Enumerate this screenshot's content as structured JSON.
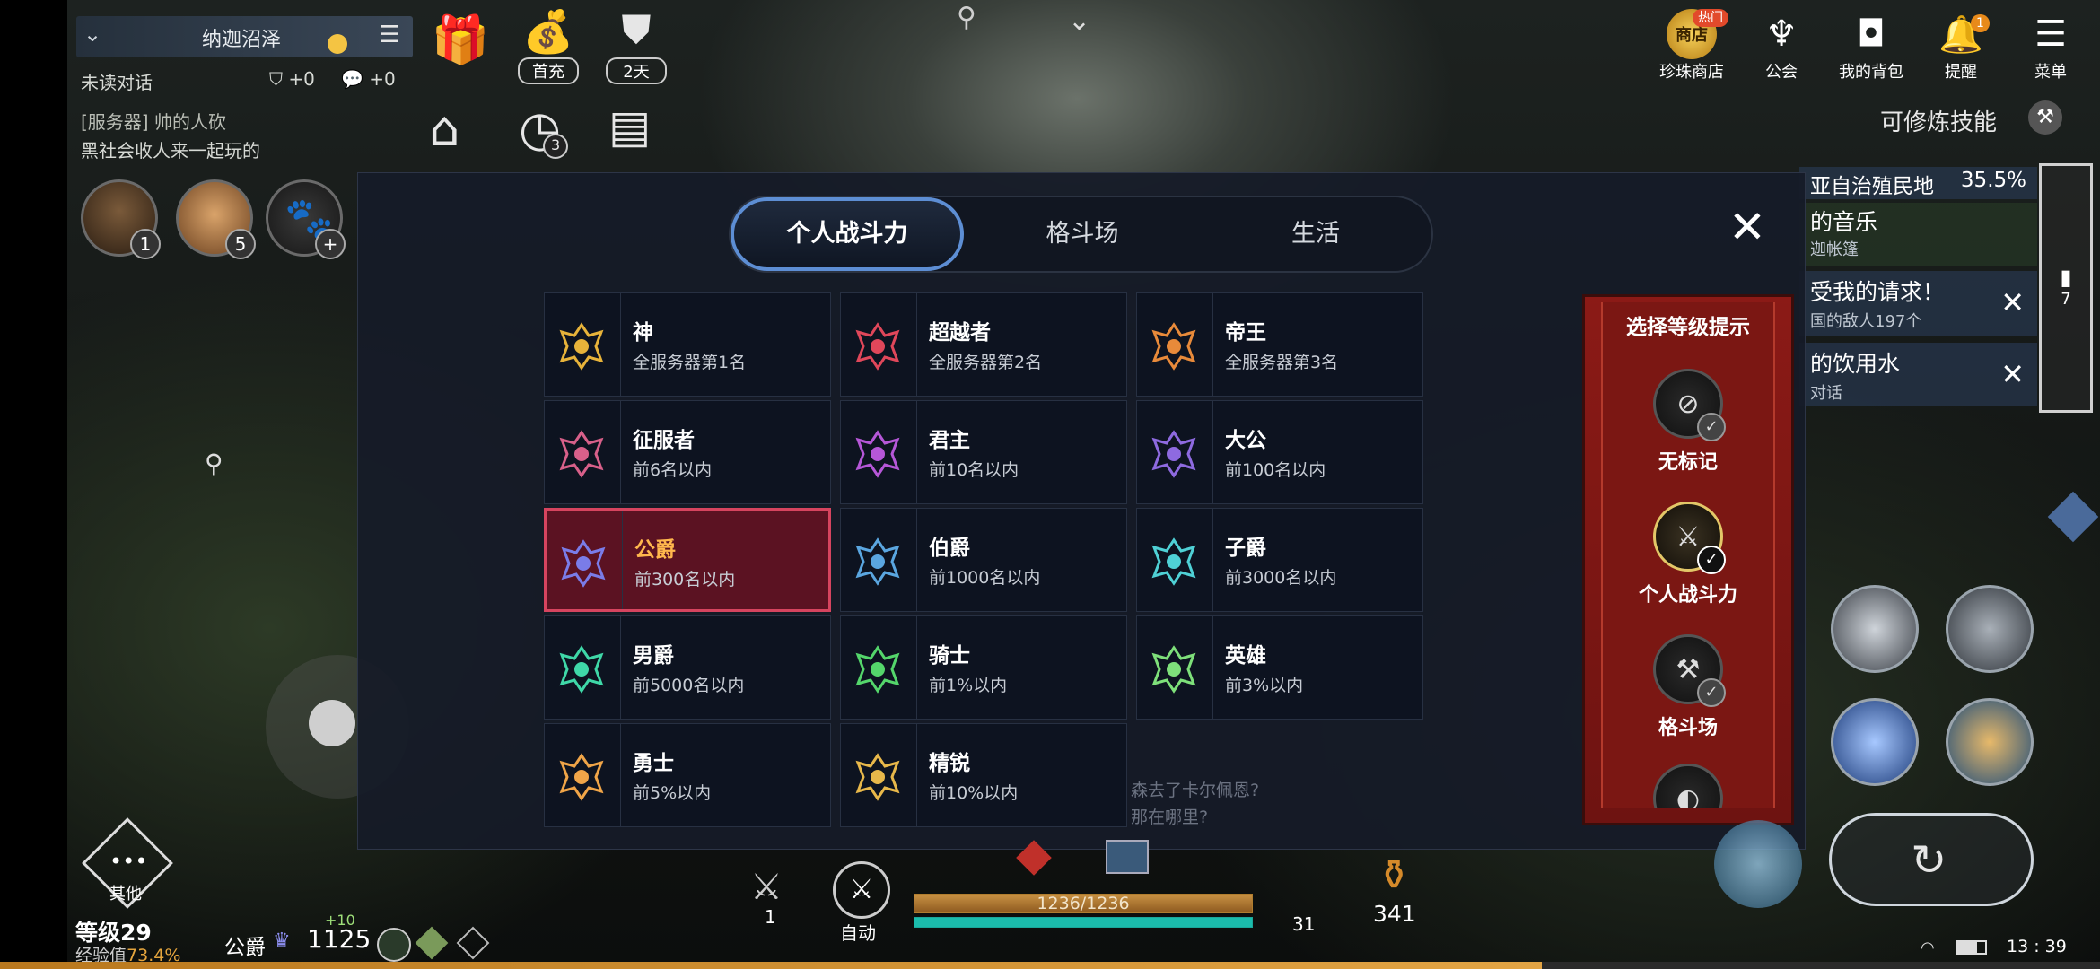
{
  "top_left": {
    "zone_name": "纳迦沼泽",
    "unread_label": "未读对话",
    "shield_count": "+0",
    "chat_count": "+0",
    "chat_lines": [
      "[服务器] 帅的人砍",
      "黑社会收人来一起玩的"
    ],
    "shortcuts": [
      {
        "icon": "gift-icon",
        "label": ""
      },
      {
        "icon": "money-bag-icon",
        "label": "首充"
      },
      {
        "icon": "shield-badge-icon",
        "label": "2天"
      }
    ],
    "shortcuts2": [
      {
        "icon": "house-icon",
        "badge": ""
      },
      {
        "icon": "timer-icon",
        "badge": "3"
      },
      {
        "icon": "board-icon",
        "badge": ""
      }
    ],
    "party": [
      {
        "icon": "boar-avatar-icon",
        "num": "1"
      },
      {
        "icon": "dog-avatar-icon",
        "num": "5"
      },
      {
        "icon": "paw-avatar-icon",
        "num": "+"
      }
    ]
  },
  "top_right": {
    "icons": [
      {
        "name": "pearl-shop",
        "label": "珍珠商店",
        "badge": "热门",
        "glyph": "商店"
      },
      {
        "name": "guild",
        "label": "公会",
        "badge": "",
        "glyph": "♆"
      },
      {
        "name": "bag",
        "label": "我的背包",
        "badge": "",
        "glyph": "◘"
      },
      {
        "name": "alert",
        "label": "提醒",
        "badge": "1",
        "glyph": "🔔"
      },
      {
        "name": "menu",
        "label": "菜单",
        "badge": "",
        "glyph": "☰"
      }
    ],
    "skill_notice": "可修炼技能"
  },
  "quests": [
    {
      "title": "亚自治殖民地",
      "sub": "",
      "value": "35.5%"
    },
    {
      "title": "的音乐",
      "sub": "迦帐篷"
    },
    {
      "title": "受我的请求！",
      "sub": "国的敌人197个"
    },
    {
      "title": "的饮用水",
      "sub": "对话"
    }
  ],
  "side_counter": "7",
  "modal": {
    "tabs": [
      "个人战斗力",
      "格斗场",
      "生活"
    ],
    "active_tab": 0,
    "ranks": [
      {
        "title": "神",
        "desc": "全服务器第1名",
        "color": "#e7b33a",
        "icon": "god-emblem-icon"
      },
      {
        "title": "超越者",
        "desc": "全服务器第2名",
        "color": "#e0475a",
        "icon": "transcender-emblem-icon"
      },
      {
        "title": "帝王",
        "desc": "全服务器第3名",
        "color": "#e88a3a",
        "icon": "emperor-emblem-icon"
      },
      {
        "title": "征服者",
        "desc": "前6名以内",
        "color": "#d8608a",
        "icon": "conqueror-emblem-icon"
      },
      {
        "title": "君主",
        "desc": "前10名以内",
        "color": "#b657d8",
        "icon": "monarch-emblem-icon"
      },
      {
        "title": "大公",
        "desc": "前100名以内",
        "color": "#8e6ae0",
        "icon": "archduke-emblem-icon"
      },
      {
        "title": "公爵",
        "desc": "前300名以内",
        "color": "#7a7ce8",
        "icon": "duke-emblem-icon"
      },
      {
        "title": "伯爵",
        "desc": "前1000名以内",
        "color": "#5aa6e0",
        "icon": "count-emblem-icon"
      },
      {
        "title": "子爵",
        "desc": "前3000名以内",
        "color": "#4fd1d6",
        "icon": "viscount-emblem-icon"
      },
      {
        "title": "男爵",
        "desc": "前5000名以内",
        "color": "#3fd8a8",
        "icon": "baron-emblem-icon"
      },
      {
        "title": "骑士",
        "desc": "前1%以内",
        "color": "#54d66b",
        "icon": "knight-emblem-icon"
      },
      {
        "title": "英雄",
        "desc": "前3%以内",
        "color": "#7ee07a",
        "icon": "hero-emblem-icon"
      },
      {
        "title": "勇士",
        "desc": "前5%以内",
        "color": "#f0a548",
        "icon": "warrior-emblem-icon"
      },
      {
        "title": "精锐",
        "desc": "前10%以内",
        "color": "#e8b84a",
        "icon": "elite-emblem-icon"
      }
    ],
    "selected_rank": 6,
    "close_label": "✕",
    "panel": {
      "title": "选择等级提示",
      "options": [
        {
          "label": "无标记",
          "glyph": "⊘",
          "on": false
        },
        {
          "label": "个人战斗力",
          "glyph": "⚔",
          "on": true
        },
        {
          "label": "格斗场",
          "glyph": "⚒",
          "on": false
        },
        {
          "label": "",
          "glyph": "◐",
          "on": false
        }
      ]
    },
    "bg_ghost_text": [
      "森去了卡尔佩恩?",
      "那在哪里?"
    ]
  },
  "bottom": {
    "other_label": "其他",
    "level_label": "等级29",
    "exp_label": "经验值",
    "exp_value": "73.4%",
    "rank_label": "公爵",
    "power_value": "1125",
    "power_delta": "+10",
    "weapon_count": "1",
    "auto_label": "自动",
    "hp_text": "1236/1236",
    "hp_ratio": 1.0,
    "mp_ratio": 1.0,
    "item_count_1": "31",
    "potion_count": "341",
    "time": "13 : 39",
    "xp_ratio": 0.734
  }
}
